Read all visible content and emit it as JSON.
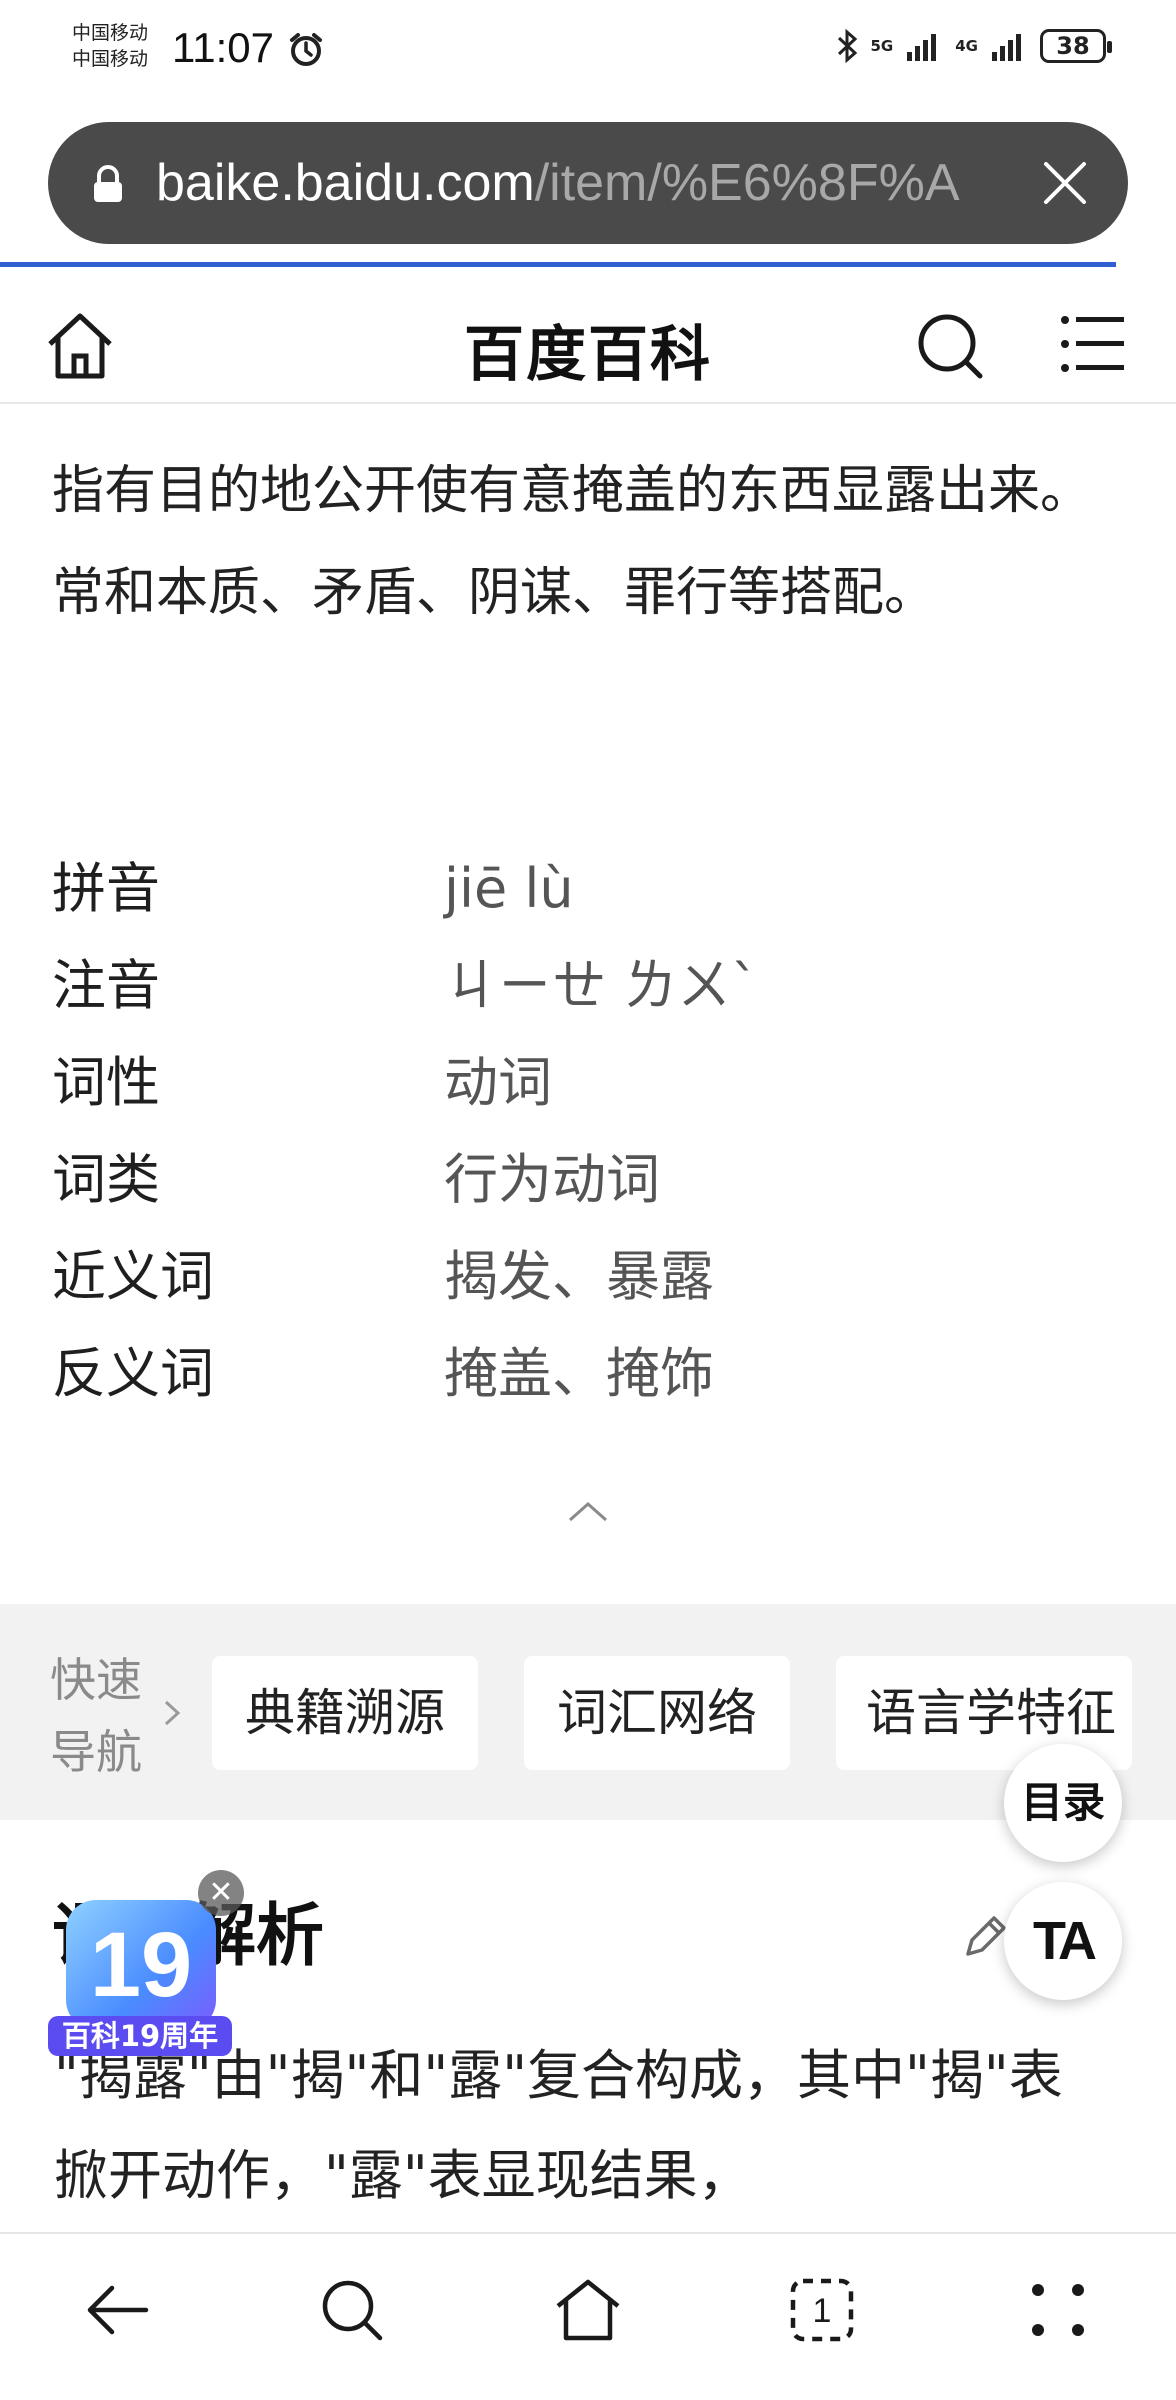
{
  "status_bar": {
    "carrier_1": "中国移动",
    "carrier_2": "中国移动",
    "time": "11:07",
    "network_a": "5G",
    "network_b": "4G",
    "battery": "38"
  },
  "url_bar": {
    "host": "baike.baidu.com",
    "path": "/item/%E6%8F%A"
  },
  "site_nav": {
    "title": "百度百科"
  },
  "summary": "指有目的地公开使有意掩盖的东西显露出来。常和本质、矛盾、阴谋、罪行等搭配。",
  "info": [
    {
      "label": "拼音",
      "value": "jiē lù"
    },
    {
      "label": "注音",
      "value": "ㄐㄧㄝ ㄌㄨˋ"
    },
    {
      "label": "词性",
      "value": "动词"
    },
    {
      "label": "词类",
      "value": "行为动词"
    },
    {
      "label": "近义词",
      "value": "揭发、暴露"
    },
    {
      "label": "反义词",
      "value": "掩盖、掩饰"
    }
  ],
  "quick_nav": {
    "label": "快速导航",
    "items": [
      "典籍溯源",
      "词汇网络",
      "语言学特征"
    ]
  },
  "section": {
    "title": "语义解析",
    "body": "\"揭露\"由\"揭\"和\"露\"复合构成，其中\"揭\"表掀开动作，\"露\"表显现结果，"
  },
  "floating": {
    "toc": "目录",
    "ta": "TA"
  },
  "badge": {
    "number": "19",
    "label": "百科19周年"
  }
}
